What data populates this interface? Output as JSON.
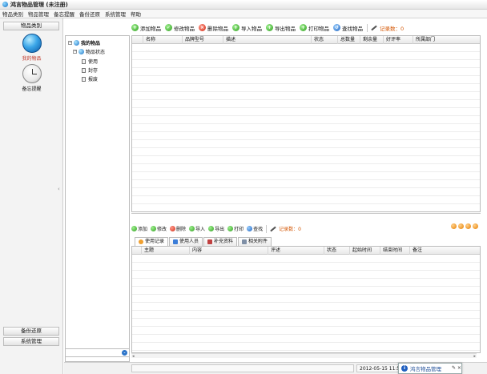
{
  "window": {
    "title": "鸿言物品管理 (未注册)"
  },
  "menu": [
    "物品类别",
    "物品管理",
    "备忘提醒",
    "备份还原",
    "系统管理",
    "帮助"
  ],
  "sidebar": {
    "header": "物品类别",
    "items": [
      {
        "label": "我的物品",
        "icon": "globe-icon",
        "active": true
      },
      {
        "label": "备忘提醒",
        "icon": "clock-icon",
        "active": false
      }
    ],
    "bottom_buttons": [
      "备份还原",
      "系统管理"
    ]
  },
  "tree": {
    "root": "我的物品",
    "child": "物品状态",
    "leaves": [
      "使用",
      "封存",
      "报废"
    ]
  },
  "toolbar": {
    "buttons": [
      {
        "label": "添加物品",
        "icon": "add-icon",
        "symbol": "+",
        "color": "green"
      },
      {
        "label": "修改物品",
        "icon": "edit-icon",
        "symbol": "✓",
        "color": "green"
      },
      {
        "label": "删除物品",
        "icon": "delete-icon",
        "symbol": "×",
        "color": "red"
      },
      {
        "label": "导入物品",
        "icon": "import-icon",
        "symbol": "+",
        "color": "green"
      },
      {
        "label": "导出物品",
        "icon": "export-icon",
        "symbol": "+",
        "color": "green"
      },
      {
        "label": "打印物品",
        "icon": "print-icon",
        "symbol": "+",
        "color": "green"
      },
      {
        "label": "查找物品",
        "icon": "find-icon",
        "symbol": "↺",
        "color": "blue"
      }
    ],
    "record_count": "记录数：0"
  },
  "main_table": {
    "columns": [
      "名称",
      "品牌型号",
      "描述",
      "状态",
      "总数量",
      "剩余量",
      "好评率",
      "所属部门"
    ]
  },
  "sub_toolbar": {
    "buttons": [
      {
        "label": "添加",
        "icon": "add-icon",
        "color": "green"
      },
      {
        "label": "修改",
        "icon": "edit-icon",
        "color": "green"
      },
      {
        "label": "删除",
        "icon": "delete-icon",
        "color": "red"
      },
      {
        "label": "导入",
        "icon": "import-icon",
        "color": "green"
      },
      {
        "label": "导出",
        "icon": "export-icon",
        "color": "green"
      },
      {
        "label": "打印",
        "icon": "print-icon",
        "color": "green"
      },
      {
        "label": "查找",
        "icon": "find-icon",
        "color": "blue"
      }
    ],
    "record_count": "记录数：0"
  },
  "tabs": [
    {
      "label": "使用记录",
      "active": true
    },
    {
      "label": "使用人员",
      "active": false
    },
    {
      "label": "补充资料",
      "active": false
    },
    {
      "label": "相关附件",
      "active": false
    }
  ],
  "sub_table": {
    "columns": [
      "主题",
      "内容",
      "评述",
      "状态",
      "起始时间",
      "结束时间",
      "备注"
    ]
  },
  "status": {
    "datetime": "2012-05-15 11:5",
    "popup_title": "鸿言物品管理",
    "popup_controls": "✎ ×"
  },
  "colors": {
    "green": "#2e9d1e",
    "red": "#d12b17",
    "blue": "#1a5fbe",
    "record": "#d35400"
  }
}
